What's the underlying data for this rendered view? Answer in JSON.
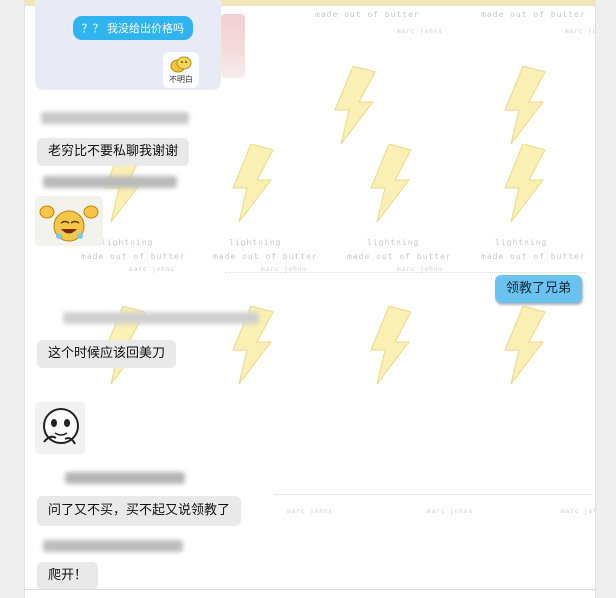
{
  "quote": {
    "text": "？？ 我没给出价格吗",
    "sticker_label": "不明白"
  },
  "wallpaper": {
    "brand": "made out of butter",
    "author": "marc johns",
    "word": "lightning"
  },
  "messages": [
    {
      "side": "left",
      "type": "text",
      "text": "老穷比不要私聊我谢谢"
    },
    {
      "side": "left",
      "type": "sticker",
      "sticker": "laughing-face-sticker"
    },
    {
      "side": "right",
      "type": "text",
      "text": "领教了兄弟"
    },
    {
      "side": "left",
      "type": "text",
      "text": "这个时候应该回美刀"
    },
    {
      "side": "left",
      "type": "sticker",
      "sticker": "panda-meme-sticker"
    },
    {
      "side": "left",
      "type": "text",
      "text": "问了又不买，买不起又说领教了"
    },
    {
      "side": "left",
      "type": "text",
      "text": "爬开！"
    }
  ],
  "colors": {
    "right_bubble": "#6cc2ee",
    "left_bubble": "#e9e9e9",
    "quote_bubble": "#2fb4f0",
    "quote_card": "#e8ebf6",
    "bolt": "#fbf0b3"
  }
}
